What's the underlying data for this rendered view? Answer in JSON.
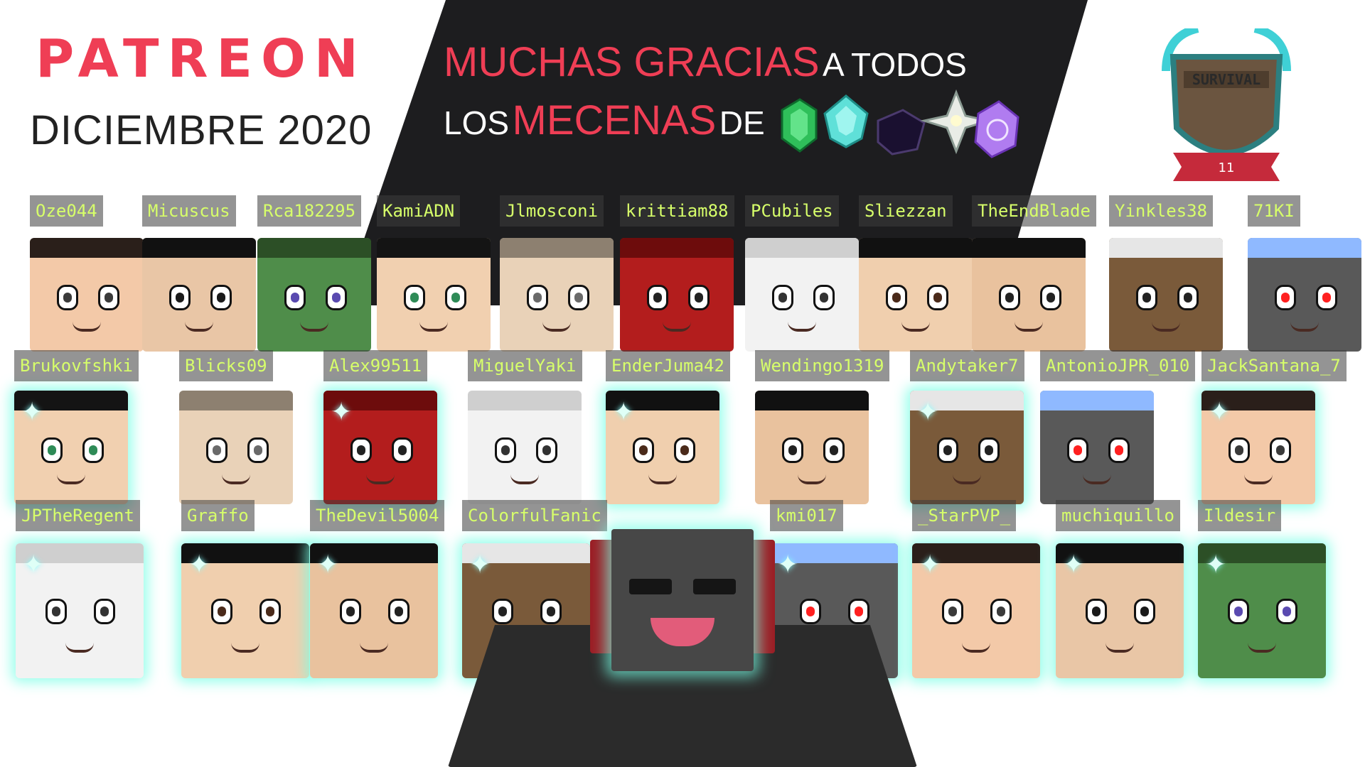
{
  "header": {
    "brand": "PATREON",
    "subtitle": "DICIEMBRE 2020",
    "thanks_line1_big": "MUCHAS GRACIAS",
    "thanks_line1_small": "A TODOS",
    "thanks_line2_small_a": "LOS",
    "thanks_line2_big": "MECENAS",
    "thanks_line2_small_b": "DE",
    "gem_icons": [
      "emerald-icon",
      "diamond-icon",
      "obsidian-icon",
      "nether-star-icon",
      "enchanted-crystal-icon"
    ]
  },
  "badge": {
    "text": "SURVIVAL",
    "ribbon_number": "11"
  },
  "colors": {
    "accent_red": "#ef3e55",
    "banner_dark": "#1d1d1f",
    "name_text": "#d7ff6a",
    "glow": "#78ffe6"
  },
  "rows": {
    "row1": [
      "Oze044",
      "Micuscus",
      "Rca182295",
      "KamiADN",
      "Jlmosconi",
      "krittiam88",
      "PCubiles",
      "Sliezzan",
      "TheEndBlade",
      "Yinkles38",
      "71KI"
    ],
    "row2": [
      "Brukovfshki",
      "Blicks09",
      "Alex99511",
      "MiguelYaki",
      "EnderJuma42",
      "Wendingo1319",
      "Andytaker7",
      "AntonioJPR_010",
      "JackSantana_7"
    ],
    "row3": [
      "JPTheRegent",
      "Graffo",
      "TheDevil5004",
      "ColorfulFanic",
      "kmi017",
      "_StarPVP_",
      "muchiquillo",
      "Ildesir"
    ]
  }
}
